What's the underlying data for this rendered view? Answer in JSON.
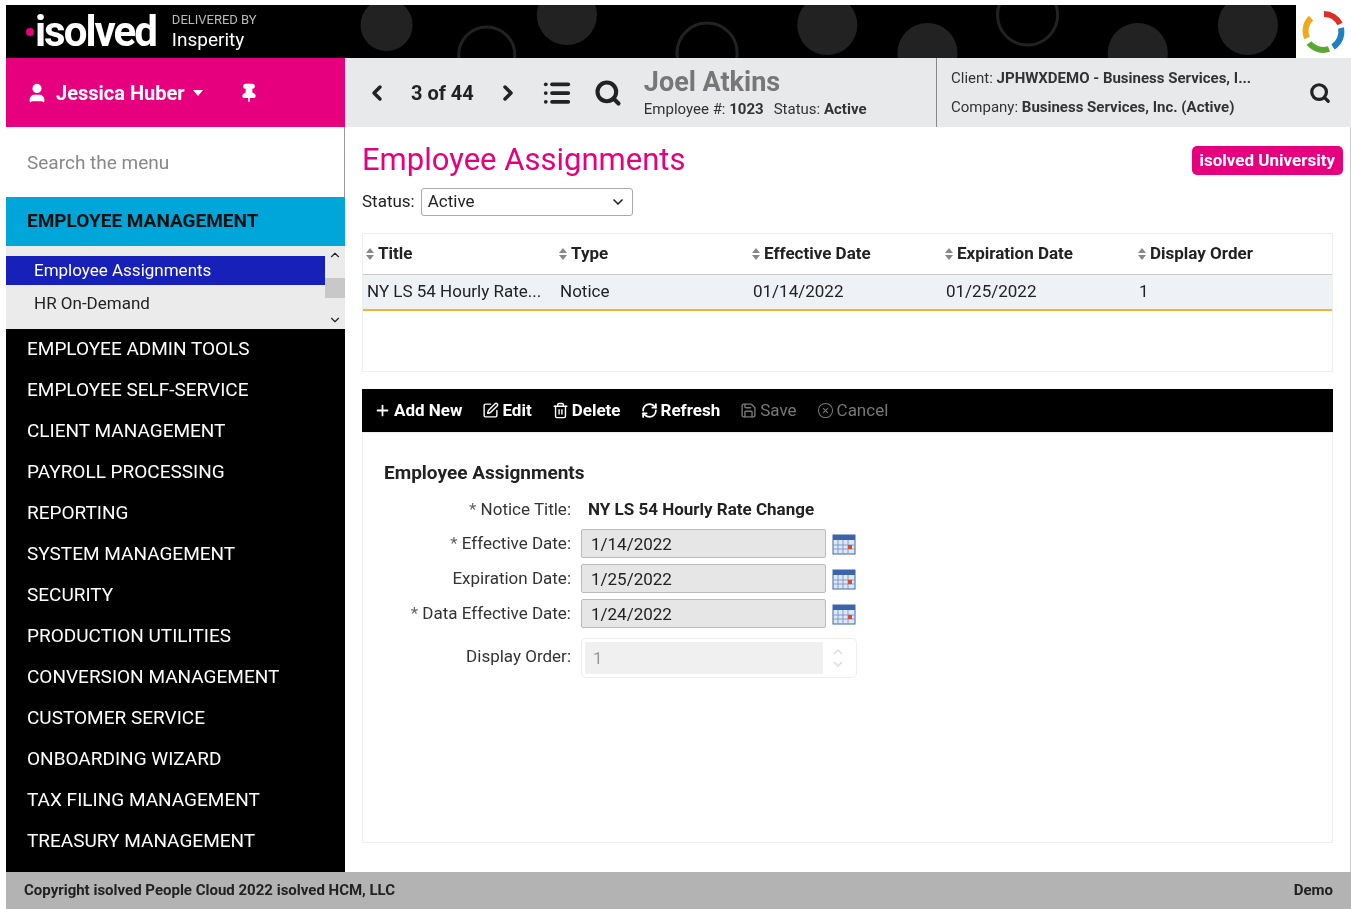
{
  "header": {
    "logo": "isolved",
    "delivered_by": "DELIVERED BY",
    "partner": "Insperity"
  },
  "user": {
    "name": "Jessica Huber"
  },
  "record_nav": {
    "position": "3 of 44"
  },
  "employee": {
    "name": "Joel Atkins",
    "number_label": "Employee #:",
    "number": "1023",
    "status_label": "Status:",
    "status": "Active"
  },
  "client": {
    "client_label": "Client:",
    "client": "JPHWXDEMO - Business Services, I...",
    "company_label": "Company:",
    "company": "Business Services, Inc. (Active)"
  },
  "sidebar": {
    "search_placeholder": "Search the menu",
    "section": "EMPLOYEE MANAGEMENT",
    "sub_items": [
      {
        "label": "Employee Assignments",
        "selected": true
      },
      {
        "label": "HR On-Demand",
        "selected": false
      }
    ],
    "items": [
      "EMPLOYEE ADMIN TOOLS",
      "EMPLOYEE SELF-SERVICE",
      "CLIENT MANAGEMENT",
      "PAYROLL PROCESSING",
      "REPORTING",
      "SYSTEM MANAGEMENT",
      "SECURITY",
      "PRODUCTION UTILITIES",
      "CONVERSION MANAGEMENT",
      "CUSTOMER SERVICE",
      "ONBOARDING WIZARD",
      "TAX FILING MANAGEMENT",
      "TREASURY MANAGEMENT"
    ]
  },
  "page": {
    "title": "Employee Assignments",
    "badge": "isolved University",
    "status_label": "Status:",
    "status_value": "Active"
  },
  "table": {
    "columns": [
      "Title",
      "Type",
      "Effective Date",
      "Expiration Date",
      "Display Order"
    ],
    "rows": [
      {
        "cells": [
          "NY LS 54 Hourly Rate...",
          "Notice",
          "01/14/2022",
          "01/25/2022",
          "1"
        ],
        "selected": true
      }
    ]
  },
  "toolbar": [
    {
      "kind": "add",
      "label": "Add New",
      "disabled": false
    },
    {
      "kind": "edit",
      "label": "Edit",
      "disabled": false
    },
    {
      "kind": "delete",
      "label": "Delete",
      "disabled": false
    },
    {
      "kind": "refresh",
      "label": "Refresh",
      "disabled": false
    },
    {
      "kind": "save",
      "label": "Save",
      "disabled": true
    },
    {
      "kind": "cancel",
      "label": "Cancel",
      "disabled": true
    }
  ],
  "form": {
    "title": "Employee Assignments",
    "required_mark": "*",
    "fields": [
      {
        "kind": "text",
        "label": "Notice Title:",
        "required": true,
        "value": "NY LS 54 Hourly Rate Change"
      },
      {
        "kind": "date",
        "label": "Effective Date:",
        "required": true,
        "value": "1/14/2022"
      },
      {
        "kind": "date",
        "label": "Expiration Date:",
        "required": false,
        "value": "1/25/2022"
      },
      {
        "kind": "date",
        "label": "Data Effective Date:",
        "required": true,
        "value": "1/24/2022"
      },
      {
        "kind": "number",
        "label": "Display Order:",
        "required": false,
        "value": "1",
        "disabled": true
      }
    ]
  },
  "footer": {
    "copyright": "Copyright isolved People Cloud 2022 isolved HCM, LLC",
    "environment": "Demo"
  }
}
